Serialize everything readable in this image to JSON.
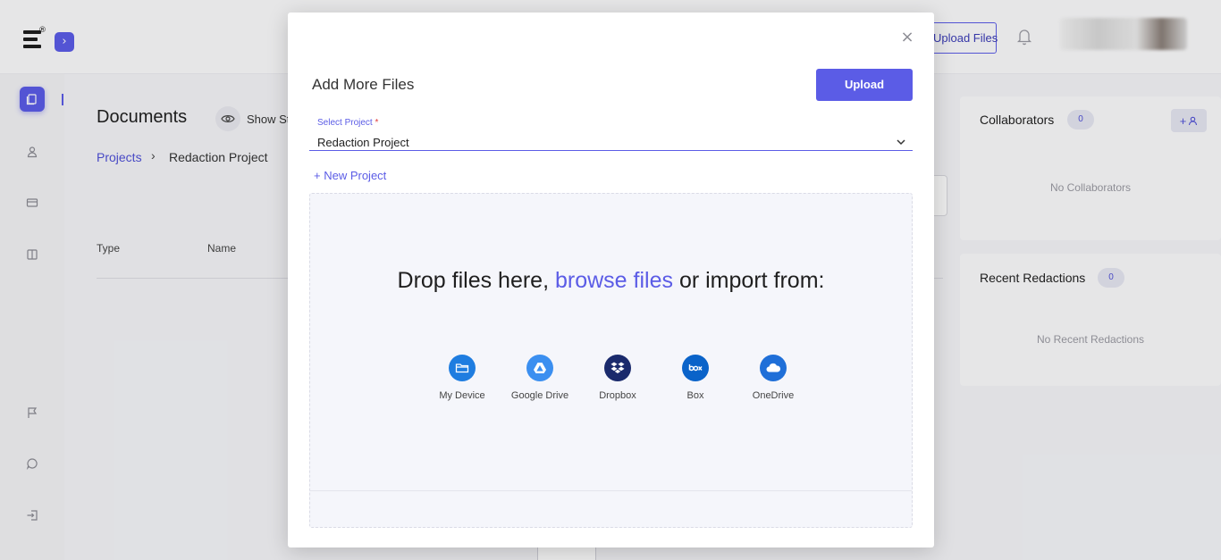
{
  "app": {
    "header": {
      "upload_files_label": "Upload Files"
    },
    "page": {
      "title": "Documents",
      "show_label": "Show St",
      "breadcrumb": {
        "root": "Projects",
        "separator": "›",
        "current": "Redaction Project"
      },
      "columns": {
        "type": "Type",
        "name": "Name"
      }
    },
    "collaborators": {
      "title": "Collaborators",
      "count": "0",
      "empty": "No Collaborators",
      "add_label": "+"
    },
    "recent_redactions": {
      "title": "Recent Redactions",
      "count": "0",
      "empty": "No Recent Redactions"
    }
  },
  "modal": {
    "title": "Add More Files",
    "close_label": "×",
    "upload_label": "Upload",
    "select_project": {
      "label": "Select Project",
      "required_mark": "*",
      "value": "Redaction Project"
    },
    "new_project_label": "+ New Project",
    "dropzone": {
      "text_before": "Drop files here,",
      "link_text": "browse files",
      "text_after": "or import from:"
    },
    "sources": [
      {
        "label": "My Device",
        "icon": "folder-icon",
        "color": "#1f7de0"
      },
      {
        "label": "Google Drive",
        "icon": "google-drive-icon",
        "color": "#3b8ff0"
      },
      {
        "label": "Dropbox",
        "icon": "dropbox-icon",
        "color": "#1a2a6c"
      },
      {
        "label": "Box",
        "icon": "box-icon",
        "color": "#0a63c9"
      },
      {
        "label": "OneDrive",
        "icon": "cloud-icon",
        "color": "#1f6fd8"
      }
    ]
  },
  "colors": {
    "accent": "#5b5ce6"
  }
}
